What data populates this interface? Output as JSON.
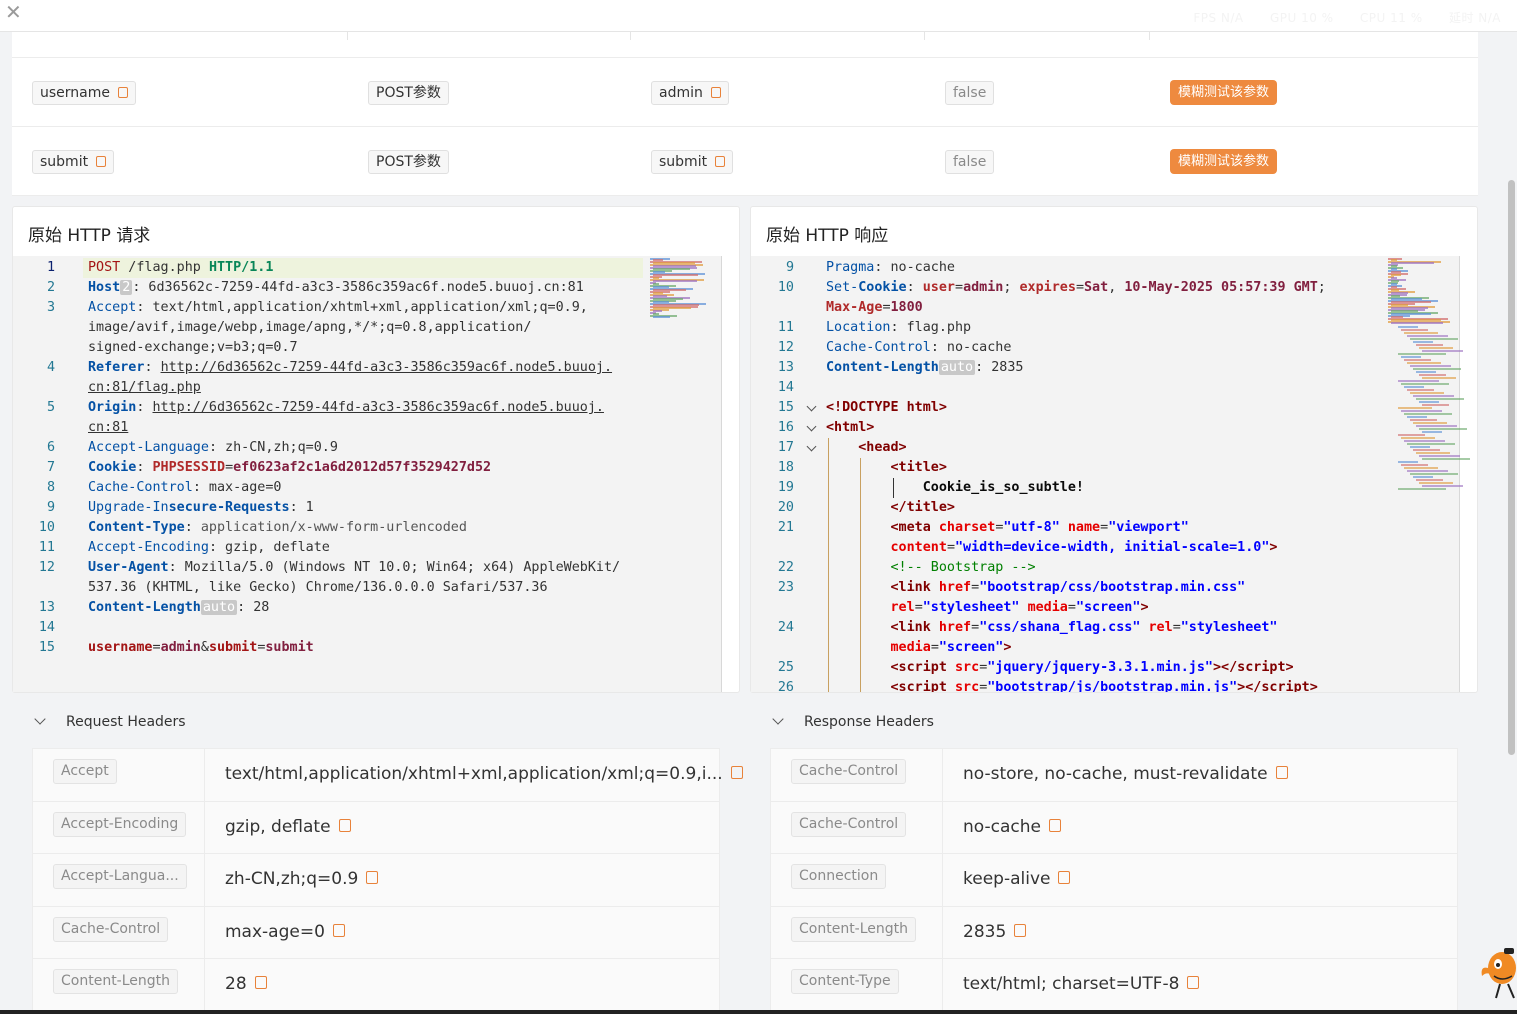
{
  "window": {
    "close_glyph": "✕",
    "stats": [
      "FPS N/A",
      "GPU 10 %",
      "CPU 11 %",
      "延时 N/A"
    ]
  },
  "params": {
    "rows": [
      {
        "name": "username",
        "type": "POST参数",
        "value": "admin",
        "flag": "false",
        "action": "模糊测试该参数"
      },
      {
        "name": "submit",
        "type": "POST参数",
        "value": "submit",
        "flag": "false",
        "action": "模糊测试该参数"
      }
    ]
  },
  "request_panel": {
    "title": "原始 HTTP 请求"
  },
  "response_panel": {
    "title": "原始 HTTP 响应"
  },
  "request_lines": [
    {
      "n": "1",
      "html": "<span class=\"kw\">POST</span> /flag.php <span class=\"ver\">HTTP/1.1</span>"
    },
    {
      "n": "2",
      "html": "<span class=\"hk\">Host</span><span class=\"auto\">2</span>: 6d36562c-7259-44fd-a3c3-3586c359ac6f.node5.buuoj.cn:81"
    },
    {
      "n": "3",
      "html": "<span class=\"hkn\">Accept</span>: text/html,application/xhtml+xml,application/xml;q=0.9,"
    },
    {
      "n": "",
      "html": "image/avif,image/webp,image/apng,*/*;q=0.8,application/"
    },
    {
      "n": "",
      "html": "signed-exchange;v=b3;q=0.7"
    },
    {
      "n": "4",
      "html": "<span class=\"hk\">Referer</span>: <u>http://6d36562c-7259-44fd-a3c3-3586c359ac6f.node5.buuoj.</u>"
    },
    {
      "n": "",
      "html": "<u>cn:81/flag.php</u>"
    },
    {
      "n": "5",
      "html": "<span class=\"hk\">Origin</span>: <u>http://6d36562c-7259-44fd-a3c3-3586c359ac6f.node5.buuoj.</u>"
    },
    {
      "n": "",
      "html": "<u>cn:81</u>"
    },
    {
      "n": "6",
      "html": "<span class=\"hkn\">Accept-Language</span>: zh-CN,zh;q=0.9"
    },
    {
      "n": "7",
      "html": "<span class=\"hk\">Cookie</span>: <span class=\"ck\">PHPSESSID</span>=<span class=\"cv\">ef0623af2c1a6d2012d57f3529427d52</span>"
    },
    {
      "n": "8",
      "html": "<span class=\"hkn\">Cache-Control</span>: max-age=0"
    },
    {
      "n": "9",
      "html": "<span class=\"hkn\">Upgrade-In</span><span class=\"hk\">secure-Requests</span>: 1"
    },
    {
      "n": "10",
      "html": "<span class=\"hk\">Content-Type</span>: <span class=\"bt\" style=\"font-weight:normal;color:#555\">application/x-www-form-urlencoded</span>"
    },
    {
      "n": "11",
      "html": "<span class=\"hkn\">Accept-Encoding</span>: gzip, deflate"
    },
    {
      "n": "12",
      "html": "<span class=\"hk\">User-Agent</span>: Mozilla/5.0 (Windows NT 10.0; Win64; x64) AppleWebKit/"
    },
    {
      "n": "",
      "html": "537.36 (KHTML, like Gecko) Chrome/136.0.0.0 Safari/537.36"
    },
    {
      "n": "13",
      "html": "<span class=\"hk\">Content-Length</span><span class=\"auto\">auto</span>: 28"
    },
    {
      "n": "14",
      "html": ""
    },
    {
      "n": "15",
      "html": "<span class=\"pb\">username</span>=<span class=\"pv\">admin</span>&amp;<span class=\"pb\">submit</span>=<span class=\"pv\">submit</span>"
    }
  ],
  "response_lines": [
    {
      "n": "9",
      "html": "<span class=\"hkn\">Pragma</span>: no-cache"
    },
    {
      "n": "10",
      "html": "<span class=\"hkn\">Set-</span><span class=\"hk\">Cookie</span>: <span class=\"ck\">user</span>=<span class=\"cv\">admin</span>; <span class=\"ck\">expires</span>=<span class=\"cv\">Sat</span>, <span class=\"cv\">10-May-2025 05:57:39 GMT</span>;"
    },
    {
      "n": "",
      "html": "<span class=\"ck\">Max-Age</span>=<span class=\"cv\">1800</span>"
    },
    {
      "n": "11",
      "html": "<span class=\"hkn\">Location</span>: flag.php"
    },
    {
      "n": "12",
      "html": "<span class=\"hkn\">Cache-Control</span>: no-cache"
    },
    {
      "n": "13",
      "html": "<span class=\"hk\">Content-Length</span><span class=\"auto\">auto</span>: 2835"
    },
    {
      "n": "14",
      "html": ""
    },
    {
      "n": "15",
      "html": "<span class=\"tg\">&lt;!DOCTYPE</span> <span class=\"tg\">html&gt;</span>"
    },
    {
      "n": "16",
      "html": "<span class=\"tg\">&lt;html&gt;</span>"
    },
    {
      "n": "17",
      "html": "    <span class=\"tg\">&lt;head&gt;</span>"
    },
    {
      "n": "18",
      "html": "        <span class=\"tg\">&lt;title&gt;</span>"
    },
    {
      "n": "19",
      "html": "            <span class=\"bt\">Cookie_is_so_subtle!</span>"
    },
    {
      "n": "20",
      "html": "        <span class=\"tg\">&lt;/title&gt;</span>"
    },
    {
      "n": "21",
      "html": "        <span class=\"tg\">&lt;meta</span> <span class=\"at\">charset</span>=<span class=\"av\">\"utf-8\"</span> <span class=\"at\">name</span>=<span class=\"av\">\"viewport\"</span>"
    },
    {
      "n": "",
      "html": "        <span class=\"at\">content</span>=<span class=\"av\">\"width=device-width, initial-scale=1.0\"</span><span class=\"tg\">&gt;</span>"
    },
    {
      "n": "22",
      "html": "        <span class=\"cm\">&lt;!-- Bootstrap --&gt;</span>"
    },
    {
      "n": "23",
      "html": "        <span class=\"tg\">&lt;link</span> <span class=\"at\">href</span>=<span class=\"av\">\"bootstrap/css/bootstrap.min.css\"</span>"
    },
    {
      "n": "",
      "html": "        <span class=\"at\">rel</span>=<span class=\"av\">\"stylesheet\"</span> <span class=\"at\">media</span>=<span class=\"av\">\"screen\"</span><span class=\"tg\">&gt;</span>"
    },
    {
      "n": "24",
      "html": "        <span class=\"tg\">&lt;link</span> <span class=\"at\">href</span>=<span class=\"av\">\"css/shana_flag.css\"</span> <span class=\"at\">rel</span>=<span class=\"av\">\"stylesheet\"</span>"
    },
    {
      "n": "",
      "html": "        <span class=\"at\">media</span>=<span class=\"av\">\"screen\"</span><span class=\"tg\">&gt;</span>"
    },
    {
      "n": "25",
      "html": "        <span class=\"tg\">&lt;script</span> <span class=\"at\">src</span>=<span class=\"av\">\"jquery/jquery-3.3.1.min.js\"</span><span class=\"tg\">&gt;&lt;/script&gt;</span>"
    },
    {
      "n": "26",
      "html": "        <span class=\"tg\">&lt;script</span> <span class=\"at\">src</span>=<span class=\"av\">\"bootstrap/js/bootstrap.min.js\"</span><span class=\"tg\">&gt;&lt;/script&gt;</span>"
    }
  ],
  "request_headers": {
    "title": "Request Headers",
    "rows": [
      {
        "key": "Accept",
        "value": "text/html,application/xhtml+xml,application/xml;q=0.9,i..."
      },
      {
        "key": "Accept-Encoding",
        "value": "gzip, deflate"
      },
      {
        "key": "Accept-Langua...",
        "value": "zh-CN,zh;q=0.9"
      },
      {
        "key": "Cache-Control",
        "value": "max-age=0"
      },
      {
        "key": "Content-Length",
        "value": "28"
      }
    ]
  },
  "response_headers": {
    "title": "Response Headers",
    "rows": [
      {
        "key": "Cache-Control",
        "value": "no-store, no-cache, must-revalidate"
      },
      {
        "key": "Cache-Control",
        "value": "no-cache"
      },
      {
        "key": "Connection",
        "value": "keep-alive"
      },
      {
        "key": "Content-Length",
        "value": "2835"
      },
      {
        "key": "Content-Type",
        "value": "text/html; charset=UTF-8"
      }
    ]
  },
  "colors": {
    "accent": "#ee8a3f",
    "line_number": "#237893",
    "keyword": "#a31515",
    "header_key": "#0451a5"
  }
}
